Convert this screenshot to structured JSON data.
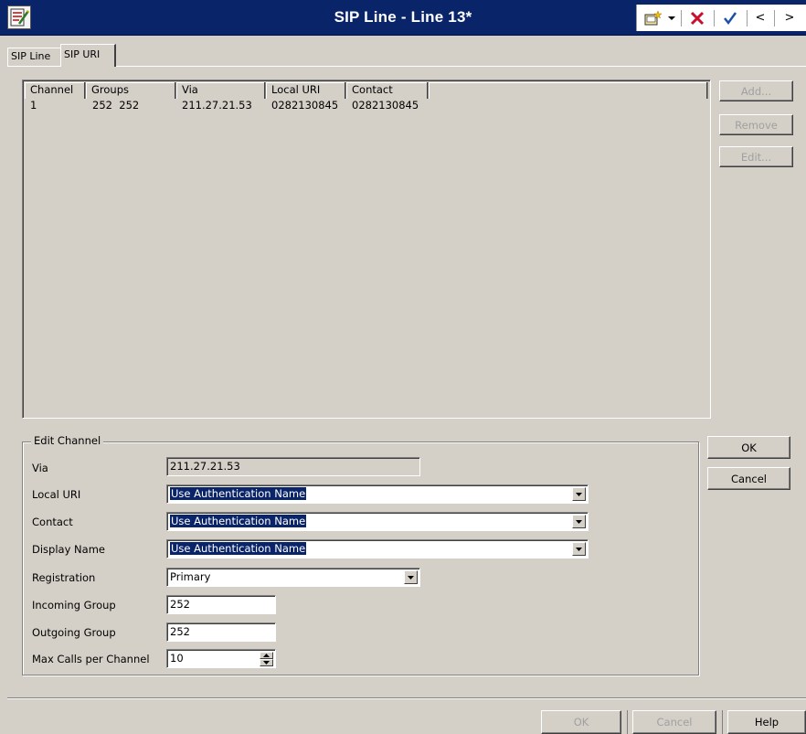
{
  "window": {
    "title": "SIP Line - Line 13*"
  },
  "toolbar": {
    "back_label": "<",
    "forward_label": ">"
  },
  "tabs": [
    {
      "label": "SIP Line"
    },
    {
      "label": "SIP URI"
    }
  ],
  "uri_list": {
    "columns": [
      "Channel",
      "Groups",
      "Via",
      "Local URI",
      "Contact"
    ],
    "rows": [
      {
        "channel": "1",
        "groups": "252  252",
        "via": "211.27.21.53",
        "local_uri": "0282130845",
        "contact": "0282130845"
      }
    ]
  },
  "list_buttons": {
    "add": "Add...",
    "remove": "Remove",
    "edit": "Edit..."
  },
  "edit_channel": {
    "title": "Edit Channel",
    "via_label": "Via",
    "via_value": "211.27.21.53",
    "local_uri_label": "Local URI",
    "local_uri_value": "Use Authentication Name",
    "contact_label": "Contact",
    "contact_value": "Use Authentication Name",
    "display_name_label": "Display Name",
    "display_name_value": "Use Authentication Name",
    "registration_label": "Registration",
    "registration_value": "Primary",
    "incoming_group_label": "Incoming Group",
    "incoming_group_value": "252",
    "outgoing_group_label": "Outgoing Group",
    "outgoing_group_value": "252",
    "max_calls_label": "Max Calls per Channel",
    "max_calls_value": "10"
  },
  "edit_buttons": {
    "ok": "OK",
    "cancel": "Cancel"
  },
  "bottom_buttons": {
    "ok": "OK",
    "cancel": "Cancel",
    "help": "Help"
  }
}
